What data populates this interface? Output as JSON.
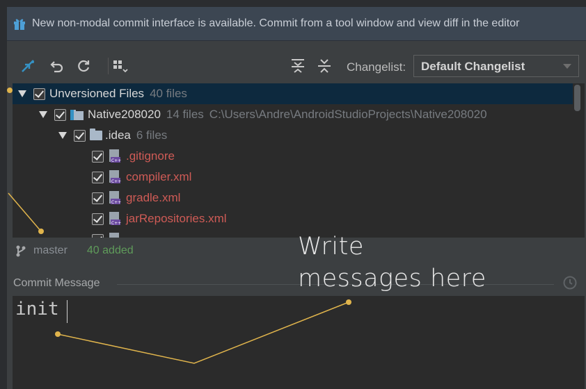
{
  "banner": {
    "text": "New non-modal commit interface is available. Commit from a tool window and view diff in the editor",
    "icon": "gift-icon"
  },
  "toolbar": {
    "icons": [
      "refresh-diff-icon",
      "rollback-icon",
      "refresh-icon",
      "group-by-icon",
      "expand-all-icon",
      "collapse-all-icon"
    ],
    "changelist_label": "Changelist:",
    "changelist_value": "Default Changelist"
  },
  "tree": {
    "root": {
      "label": "Unversioned Files",
      "count": "40 files"
    },
    "project": {
      "label": "Native208020",
      "count": "14 files",
      "path": "C:\\Users\\Andre\\AndroidStudioProjects\\Native208020"
    },
    "folder": {
      "label": ".idea",
      "count": "6 files"
    },
    "files": [
      ".gitignore",
      "compiler.xml",
      "gradle.xml",
      "jarRepositories.xml"
    ]
  },
  "status": {
    "branch": "master",
    "added": "40 added"
  },
  "commit": {
    "label": "Commit Message",
    "text": "init"
  },
  "annotation": {
    "line1": "Write",
    "line2": "messages here"
  },
  "colors": {
    "accent": "#e0b44c",
    "unversioned": "#cf5b56",
    "added": "#5f9b5a",
    "selection": "#0d293e"
  }
}
